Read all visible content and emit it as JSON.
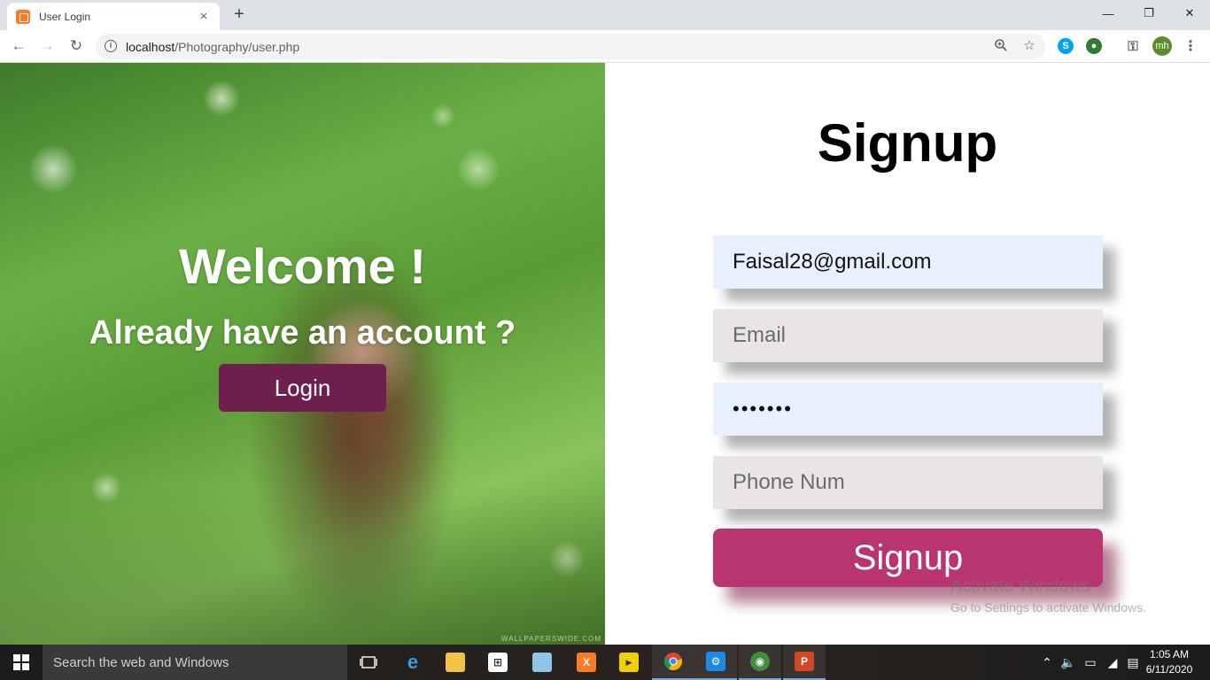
{
  "browser": {
    "tab_title": "User Login",
    "tab_close": "×",
    "new_tab": "+",
    "url_host": "localhost",
    "url_path": "/Photography/user.php",
    "back": "←",
    "forward": "→",
    "reload": "↻",
    "profile_initials": "mh",
    "minimize": "—",
    "restore": "❐",
    "close": "✕",
    "menu": "⋮"
  },
  "hero": {
    "welcome": "Welcome !",
    "prompt": "Already have an account ?",
    "login_label": "Login",
    "image_credit": "WALLPAPERSWIDE.COM"
  },
  "form": {
    "title": "Signup",
    "username_value": "Faisal28@gmail.com",
    "email_placeholder": "Email",
    "password_value": "•••••••",
    "phone_placeholder": "Phone Num",
    "submit_label": "Signup",
    "accent_color": "#b83570"
  },
  "watermark": {
    "line1": "Activate Windows",
    "line2": "Go to Settings to activate Windows."
  },
  "taskbar": {
    "search_placeholder": "Search the web and Windows",
    "time": "1:05 AM",
    "date": "6/11/2020",
    "apps": [
      "task-view",
      "edge",
      "file-explorer",
      "store",
      "notepad",
      "xampp",
      "player",
      "chrome",
      "settings",
      "network",
      "powerpoint"
    ]
  }
}
